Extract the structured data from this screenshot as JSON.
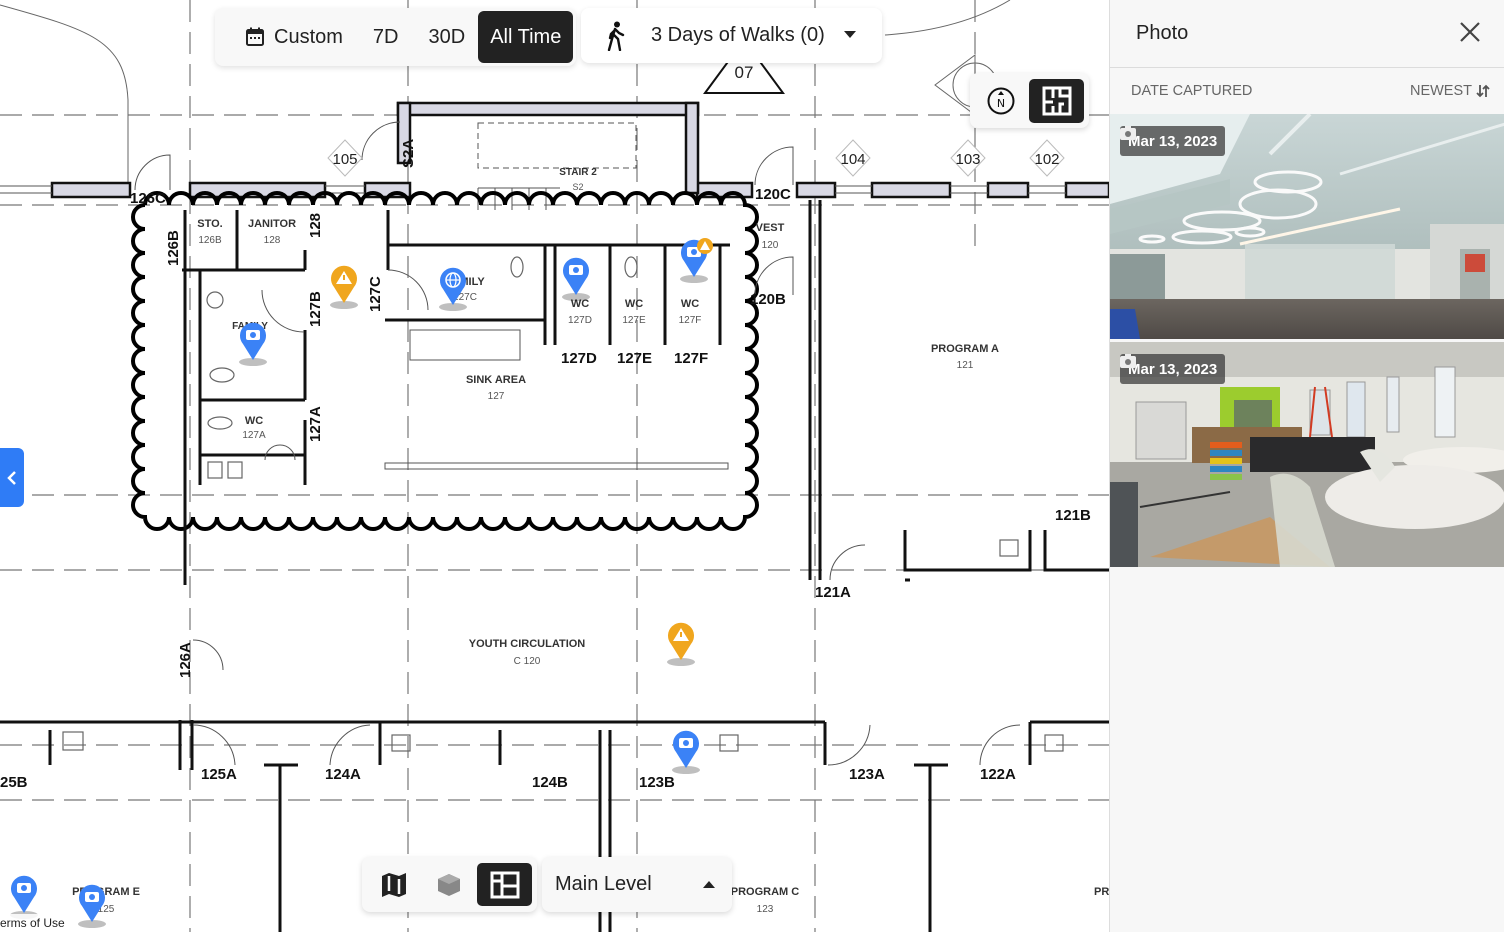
{
  "toolbar": {
    "time_filters": [
      {
        "label": "Custom",
        "icon": "calendar-icon",
        "active": false
      },
      {
        "label": "7D",
        "active": false
      },
      {
        "label": "30D",
        "active": false
      },
      {
        "label": "All Time",
        "active": true
      }
    ],
    "walks_dropdown": {
      "label": "3 Days of Walks (0)",
      "icon": "walking-person-icon"
    }
  },
  "view_toggle": {
    "north_icon": "compass-north-icon",
    "minimap_icon": "floorplan-minimap-icon"
  },
  "bottom_bar": {
    "modes": [
      {
        "name": "map",
        "icon": "map-icon",
        "active": false
      },
      {
        "name": "3d",
        "icon": "cube-icon",
        "active": false
      },
      {
        "name": "floorplan",
        "icon": "floorplan-icon",
        "active": true
      }
    ],
    "level": "Main Level"
  },
  "footer": {
    "terms": "erms of Use"
  },
  "floorplan": {
    "rooms": [
      {
        "name": "STO.",
        "number": "126B"
      },
      {
        "name": "JANITOR",
        "number": "128"
      },
      {
        "name": "FAMILY",
        "number": ""
      },
      {
        "name": "WC",
        "number": "127A"
      },
      {
        "name": "FAMILY",
        "number": "127C"
      },
      {
        "name": "WC",
        "number": "127D"
      },
      {
        "name": "WC",
        "number": "127E"
      },
      {
        "name": "WC",
        "number": "127F"
      },
      {
        "name": "SINK AREA",
        "number": "127"
      },
      {
        "name": "VEST",
        "number": "120"
      },
      {
        "name": "PROGRAM A",
        "number": "121"
      },
      {
        "name": "YOUTH CIRCULATION",
        "number": "C 120"
      },
      {
        "name": "STAIR 2",
        "number": "S2"
      },
      {
        "name": "PROGRAM E",
        "number": "125"
      },
      {
        "name": "PROGRAM C",
        "number": "123"
      },
      {
        "name": "PR",
        "number": ""
      }
    ],
    "door_labels": [
      "126C",
      "126B",
      "128",
      "127B",
      "127C",
      "127A",
      "S2A",
      "127D",
      "127E",
      "127F",
      "120C",
      "120B",
      "121A",
      "121B",
      "126A",
      "125A",
      "124A",
      "124B",
      "123B",
      "123A",
      "122A",
      "25B"
    ],
    "window_tags": [
      "105",
      "104",
      "103",
      "102",
      "07"
    ],
    "pins": [
      {
        "type": "photo",
        "color": "#3b82f6",
        "room": "FAMILY"
      },
      {
        "type": "issue",
        "color": "#f0a61e",
        "room": "127B"
      },
      {
        "type": "360",
        "color": "#3b82f6",
        "room": "127C"
      },
      {
        "type": "photo",
        "color": "#3b82f6",
        "room": "127D"
      },
      {
        "type": "photo",
        "color": "#3b82f6",
        "room": "127F",
        "badge": "issue"
      },
      {
        "type": "issue",
        "color": "#f0a61e",
        "room": "YOUTH CIRCULATION"
      },
      {
        "type": "photo",
        "color": "#3b82f6",
        "room": "123B"
      },
      {
        "type": "photo",
        "color": "#3b82f6",
        "room": "PROGRAM E"
      },
      {
        "type": "photo",
        "color": "#3b82f6",
        "room": "PROGRAM E"
      }
    ]
  },
  "panel": {
    "title": "Photo",
    "sort_label": "DATE CAPTURED",
    "sort_order": "NEWEST",
    "photos": [
      {
        "date": "Mar 13, 2023",
        "description": "Open room with ring pendant lights and glass restroom wall"
      },
      {
        "date": "Mar 13, 2023",
        "description": "Youth room with green wall, covered furniture and round tables"
      }
    ]
  },
  "colors": {
    "accent_blue": "#2f7cf6",
    "pin_blue": "#3b82f6",
    "pin_orange": "#f0a61e",
    "active_dark": "#222222"
  }
}
